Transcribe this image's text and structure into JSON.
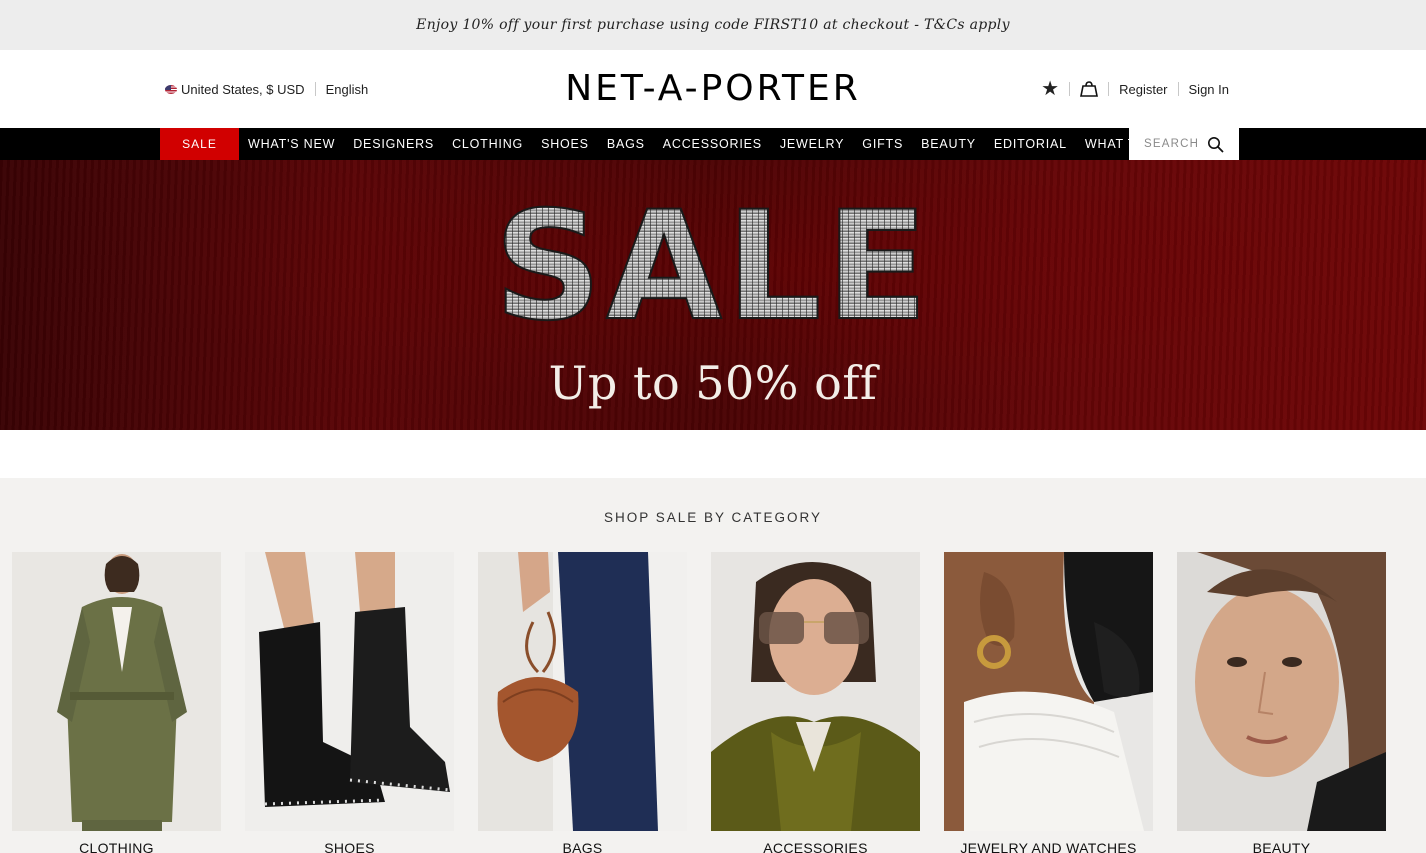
{
  "promo": {
    "text": "Enjoy 10% off your first purchase using code FIRST10 at checkout - T&Cs apply"
  },
  "header": {
    "region": "United States, $ USD",
    "language": "English",
    "logo": "NET-A-PORTER",
    "wishlist_icon": "star-icon",
    "bag_icon": "shopping-bag-icon",
    "register": "Register",
    "sign_in": "Sign In"
  },
  "nav": {
    "sale": "SALE",
    "items": [
      "WHAT'S NEW",
      "DESIGNERS",
      "CLOTHING",
      "SHOES",
      "BAGS",
      "ACCESSORIES",
      "JEWELRY",
      "GIFTS",
      "BEAUTY",
      "EDITORIAL",
      "WHAT TO WEAR"
    ],
    "search_placeholder": "SEARCH",
    "colors": {
      "sale_bg": "#d10000",
      "bar_bg": "#000000"
    }
  },
  "hero": {
    "headline": "SALE",
    "subline": "Up to 50% off",
    "colors": {
      "bg": "#5a0406"
    }
  },
  "categories": {
    "title": "SHOP SALE BY CATEGORY",
    "items": [
      {
        "label": "CLOTHING"
      },
      {
        "label": "SHOES"
      },
      {
        "label": "BAGS"
      },
      {
        "label": "ACCESSORIES"
      },
      {
        "label": "JEWELRY AND WATCHES"
      },
      {
        "label": "BEAUTY"
      }
    ]
  }
}
